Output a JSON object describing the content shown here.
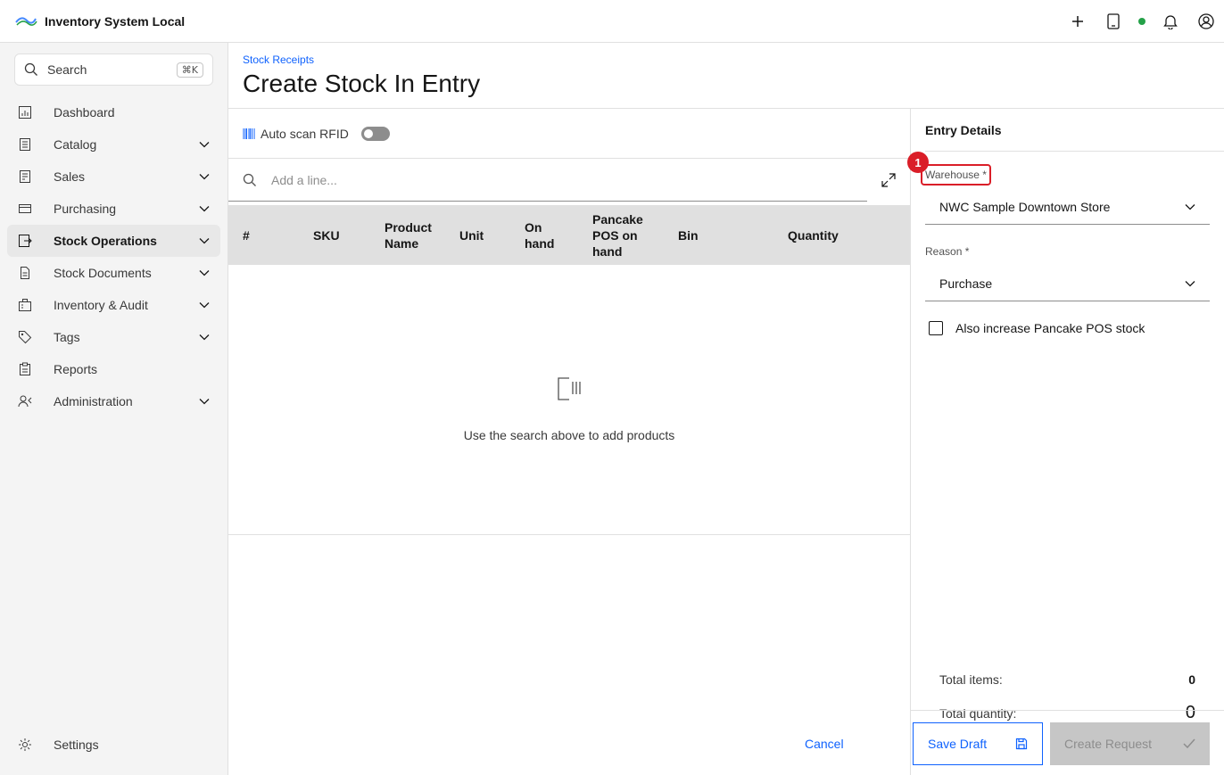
{
  "app": {
    "title": "Inventory System Local"
  },
  "header": {
    "icons": [
      "add-icon",
      "tablet-icon",
      "status-online",
      "notification-icon",
      "user-avatar-icon"
    ],
    "status_color": "#24a148"
  },
  "sidebar": {
    "search": {
      "label": "Search",
      "shortcut": "⌘K"
    },
    "items": [
      {
        "label": "Dashboard",
        "icon": "dashboard-icon",
        "expandable": false
      },
      {
        "label": "Catalog",
        "icon": "catalog-icon",
        "expandable": true
      },
      {
        "label": "Sales",
        "icon": "sales-icon",
        "expandable": true
      },
      {
        "label": "Purchasing",
        "icon": "purchasing-icon",
        "expandable": true
      },
      {
        "label": "Stock Operations",
        "icon": "stock-operations-icon",
        "expandable": true,
        "active": true
      },
      {
        "label": "Stock Documents",
        "icon": "stock-documents-icon",
        "expandable": true
      },
      {
        "label": "Inventory & Audit",
        "icon": "inventory-audit-icon",
        "expandable": true
      },
      {
        "label": "Tags",
        "icon": "tag-icon",
        "expandable": true
      },
      {
        "label": "Reports",
        "icon": "reports-icon",
        "expandable": false
      },
      {
        "label": "Administration",
        "icon": "administration-icon",
        "expandable": true
      }
    ],
    "settings_label": "Settings"
  },
  "page": {
    "breadcrumb": "Stock Receipts",
    "title": "Create Stock In Entry"
  },
  "lines": {
    "rfid_label": "Auto scan RFID",
    "search_placeholder": "Add a line...",
    "columns": [
      "#",
      "SKU",
      "Product Name",
      "Unit",
      "On hand",
      "Pancake POS on hand",
      "Bin",
      "Quantity"
    ],
    "empty_text": "Use the search above to add products",
    "cancel_label": "Cancel"
  },
  "details": {
    "title": "Entry Details",
    "annotation_badge": "1",
    "warehouse": {
      "label": "Warehouse *",
      "value": "NWC Sample Downtown Store"
    },
    "reason": {
      "label": "Reason *",
      "value": "Purchase"
    },
    "checkbox_label": "Also increase Pancake POS stock",
    "total_items_label": "Total items:",
    "total_items_value": "0",
    "total_quantity_label": "Total quantity:",
    "total_quantity_value": "0",
    "save_draft_label": "Save Draft",
    "create_request_label": "Create Request"
  },
  "colors": {
    "accent": "#0f62fe",
    "danger": "#da1e28",
    "online": "#24a148"
  }
}
